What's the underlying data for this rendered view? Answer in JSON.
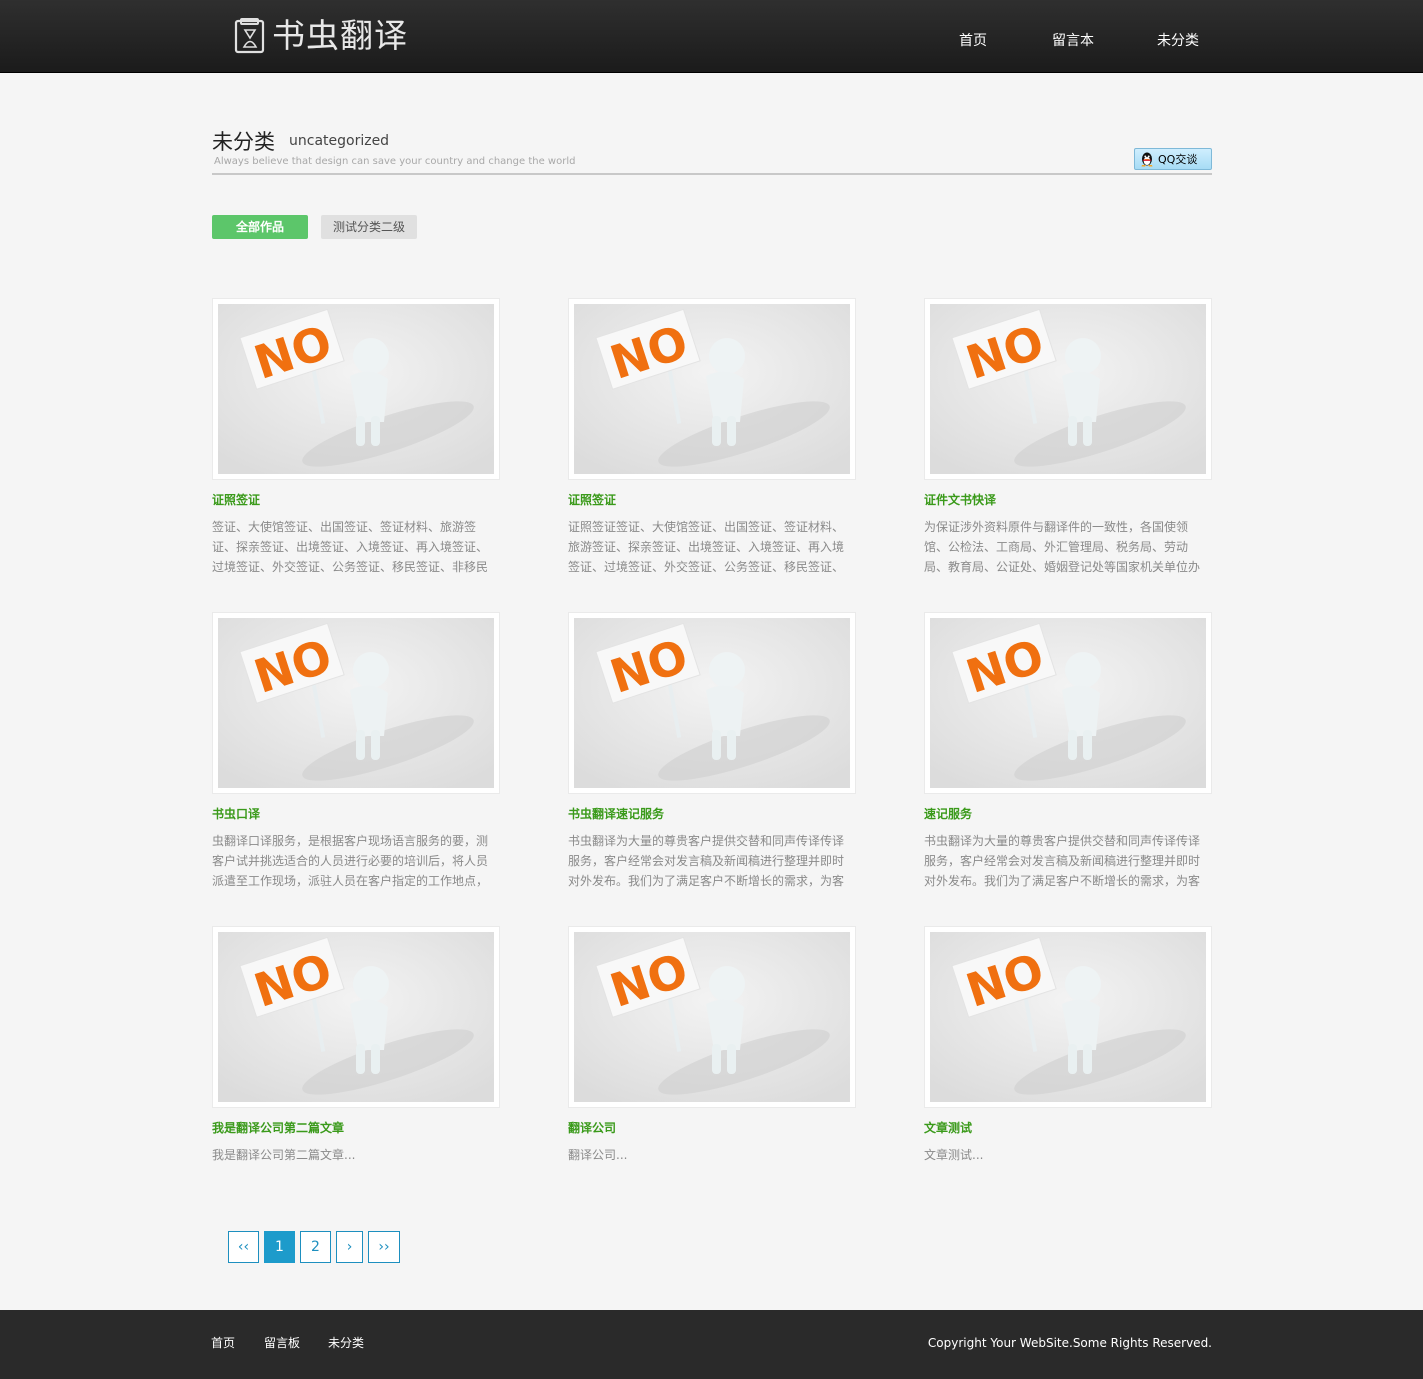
{
  "header": {
    "logo_text": "书虫翻译",
    "nav": [
      {
        "label": "首页"
      },
      {
        "label": "留言本"
      },
      {
        "label": "未分类"
      }
    ]
  },
  "category": {
    "title_cn": "未分类",
    "title_en": "uncategorized",
    "subtitle": "Always believe that design can save your country and change the world",
    "qq_label": "QQ交谈"
  },
  "filters": {
    "all_label": "全部作品",
    "sub_label": "测试分类二级"
  },
  "placeholder_text": "NO",
  "cards": [
    {
      "title": "证照签证",
      "desc": "签证、大使馆签证、出国签证、签证材料、旅游签证、探亲签证、出境签证、入境签证、再入境签证、过境签证、外交签证、公务签证、移民签证、非移民"
    },
    {
      "title": "证照签证",
      "desc": "证照签证签证、大使馆签证、出国签证、签证材料、旅游签证、探亲签证、出境签证、入境签证、再入境签证、过境签证、外交签证、公务签证、移民签证、"
    },
    {
      "title": "证件文书快译",
      "desc": "为保证涉外资料原件与翻译件的一致性，各国使领馆、公检法、工商局、外汇管理局、税务局、劳动局、教育局、公证处、婚姻登记处等国家机关单位办"
    },
    {
      "title": "书虫口译",
      "desc": "虫翻译口译服务，是根据客户现场语言服务的要，测客户试并挑选适合的人员进行必要的培训后，将人员派遣至工作现场，派驻人员在客户指定的工作地点，"
    },
    {
      "title": "书虫翻译速记服务",
      "desc": "书虫翻译为大量的尊贵客户提供交替和同声传译传译服务，客户经常会对发言稿及新闻稿进行整理并即时对外发布。我们为了满足客户不断增长的需求，为客"
    },
    {
      "title": "速记服务",
      "desc": "书虫翻译为大量的尊贵客户提供交替和同声传译传译服务，客户经常会对发言稿及新闻稿进行整理并即时对外发布。我们为了满足客户不断增长的需求，为客"
    },
    {
      "title": "我是翻译公司第二篇文章",
      "desc": "我是翻译公司第二篇文章..."
    },
    {
      "title": "翻译公司",
      "desc": "翻译公司..."
    },
    {
      "title": "文章测试",
      "desc": "文章测试..."
    }
  ],
  "pagination": {
    "first": "‹‹",
    "pages": [
      "1",
      "2"
    ],
    "current": "1",
    "next": "›",
    "last": "››"
  },
  "footer": {
    "links": [
      {
        "label": "首页"
      },
      {
        "label": "留言板"
      },
      {
        "label": "未分类"
      }
    ],
    "copyright": "Copyright Your WebSite.Some Rights Reserved."
  },
  "colors": {
    "accent_green": "#5cc66a",
    "title_green": "#3a9a1a",
    "pager_blue": "#1d9bcb",
    "placeholder_orange": "#f07010"
  }
}
